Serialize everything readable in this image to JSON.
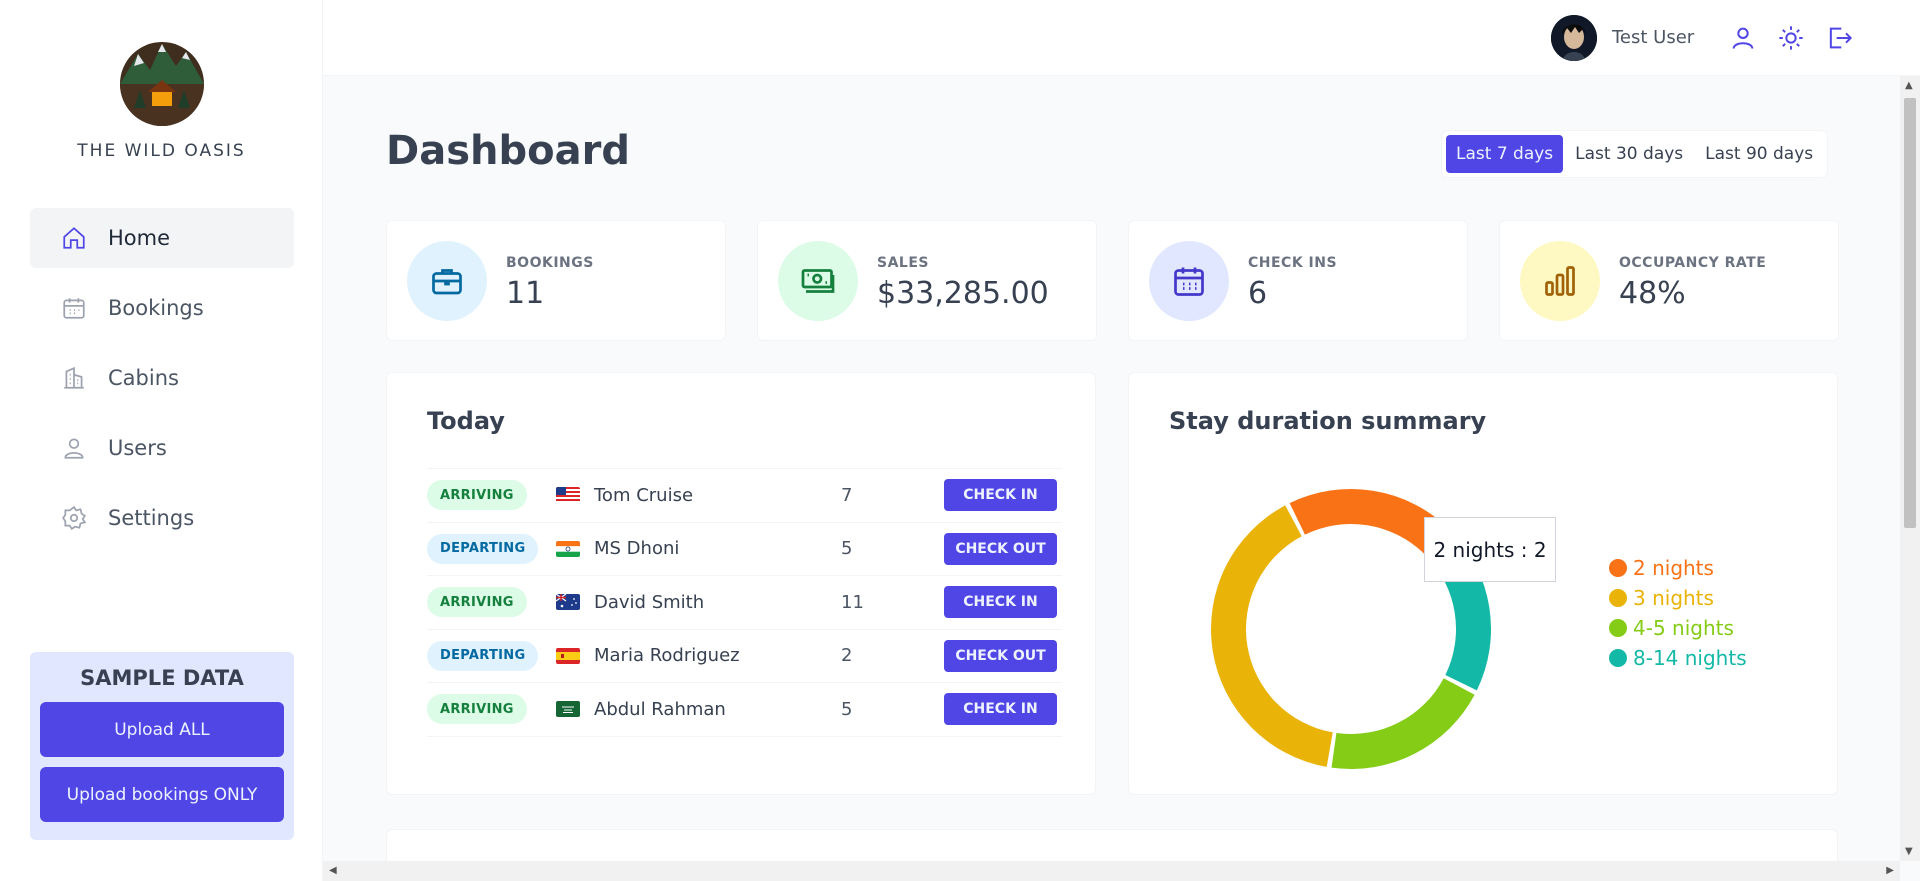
{
  "brand": {
    "name": "THE WILD OASIS"
  },
  "sidebar": {
    "items": [
      {
        "label": "Home",
        "icon": "home-icon"
      },
      {
        "label": "Bookings",
        "icon": "calendar-icon"
      },
      {
        "label": "Cabins",
        "icon": "building-icon"
      },
      {
        "label": "Users",
        "icon": "user-icon"
      },
      {
        "label": "Settings",
        "icon": "gear-icon"
      }
    ]
  },
  "sample_data": {
    "title": "SAMPLE DATA",
    "upload_all": "Upload ALL",
    "upload_bookings": "Upload bookings ONLY"
  },
  "header": {
    "user_name": "Test User"
  },
  "main": {
    "title": "Dashboard",
    "filters": [
      "Last 7 days",
      "Last 30 days",
      "Last 90 days"
    ],
    "active_filter": "Last 7 days"
  },
  "stats": [
    {
      "label": "BOOKINGS",
      "value": "11",
      "icon": "briefcase-icon",
      "color": "#0369a1",
      "bg": "#e0f2fe"
    },
    {
      "label": "SALES",
      "value": "$33,285.00",
      "icon": "banknotes-icon",
      "color": "#15803d",
      "bg": "#dcfce7"
    },
    {
      "label": "CHECK INS",
      "value": "6",
      "icon": "calendar-days-icon",
      "color": "#4338ca",
      "bg": "#e0e7ff"
    },
    {
      "label": "OCCUPANCY RATE",
      "value": "48%",
      "icon": "chart-bar-icon",
      "color": "#a16207",
      "bg": "#fef9c3"
    }
  ],
  "today": {
    "title": "Today",
    "rows": [
      {
        "status": "ARRIVING",
        "flag": "us",
        "guest": "Tom Cruise",
        "nights": "7",
        "action": "CHECK IN"
      },
      {
        "status": "DEPARTING",
        "flag": "in",
        "guest": "MS Dhoni",
        "nights": "5",
        "action": "CHECK OUT"
      },
      {
        "status": "ARRIVING",
        "flag": "au",
        "guest": "David Smith",
        "nights": "11",
        "action": "CHECK IN"
      },
      {
        "status": "DEPARTING",
        "flag": "es",
        "guest": "Maria Rodriguez",
        "nights": "2",
        "action": "CHECK OUT"
      },
      {
        "status": "ARRIVING",
        "flag": "sa",
        "guest": "Abdul Rahman",
        "nights": "5",
        "action": "CHECK IN"
      }
    ]
  },
  "stay_summary": {
    "title": "Stay duration summary",
    "tooltip": "2 nights : 2"
  },
  "chart_data": {
    "type": "pie",
    "title": "Stay duration summary",
    "categories": [
      "2 nights",
      "3 nights",
      "4-5 nights",
      "8-14 nights"
    ],
    "values": [
      2,
      4,
      2,
      2
    ],
    "colors": [
      "#f97316",
      "#eab308",
      "#84cc16",
      "#14b8a6"
    ],
    "legend": "right"
  }
}
